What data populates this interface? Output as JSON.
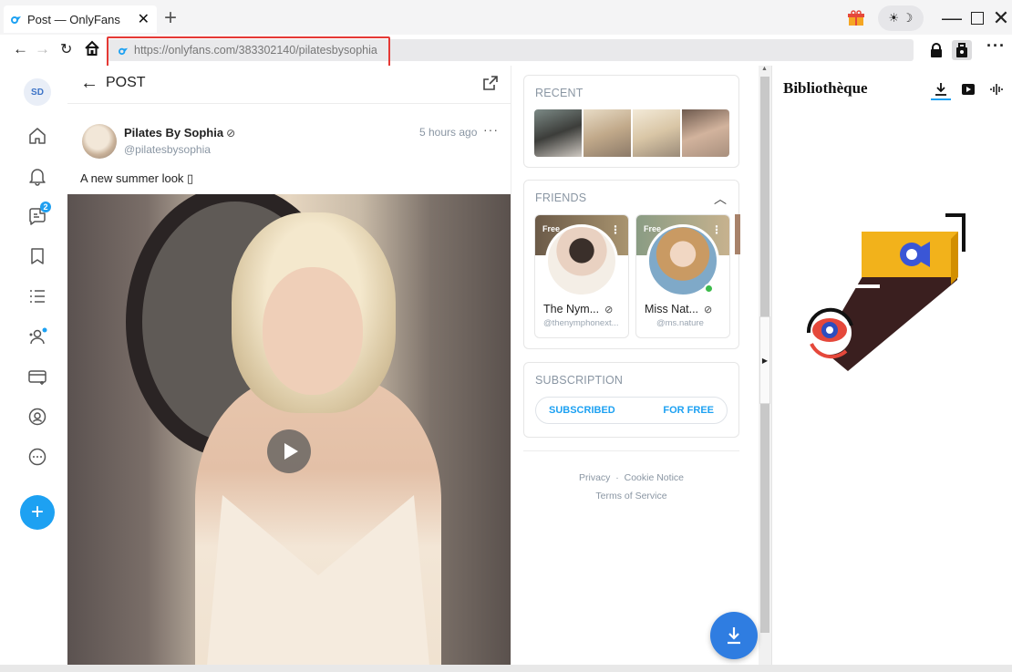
{
  "browser": {
    "tab_title": "Post — OnlyFans",
    "tab_close": "✕",
    "new_tab": "+",
    "address": "https://onlyfans.com/383302140/pilatesbysophia",
    "theme_toggle": "☀ ☽",
    "more": "···"
  },
  "sidebar": {
    "avatar_initials": "SD",
    "messages_badge": "2",
    "icons": [
      "home-icon",
      "bell-icon",
      "messages-icon",
      "bookmark-icon",
      "list-icon",
      "subscriptions-icon",
      "card-icon",
      "profile-icon",
      "more-circle-icon"
    ],
    "add_button": "+"
  },
  "post": {
    "header_title": "POST",
    "back": "←",
    "author_name": "Pilates By Sophia",
    "author_handle": "@pilatesbysophia",
    "time": "5 hours ago",
    "more": "···",
    "text": "A new summer look ▯"
  },
  "widgets": {
    "recent_title": "RECENT",
    "friends_title": "FRIENDS",
    "friends": [
      {
        "free": "Free",
        "name": "The Nym...",
        "handle": "@thenymphonext...",
        "online": false
      },
      {
        "free": "Free",
        "name": "Miss Nat...",
        "handle": "@ms.nature",
        "online": true
      }
    ],
    "subscription_title": "SUBSCRIPTION",
    "subscribed_label": "SUBSCRIBED",
    "for_free_label": "FOR FREE",
    "footer": {
      "privacy": "Privacy",
      "sep": "·",
      "cookie": "Cookie Notice",
      "terms": "Terms of Service"
    }
  },
  "library": {
    "title": "Bibliothèque"
  },
  "colors": {
    "brand_blue": "#1da1f2",
    "download_blue": "#2f7de1",
    "highlight_red": "#e53935"
  }
}
